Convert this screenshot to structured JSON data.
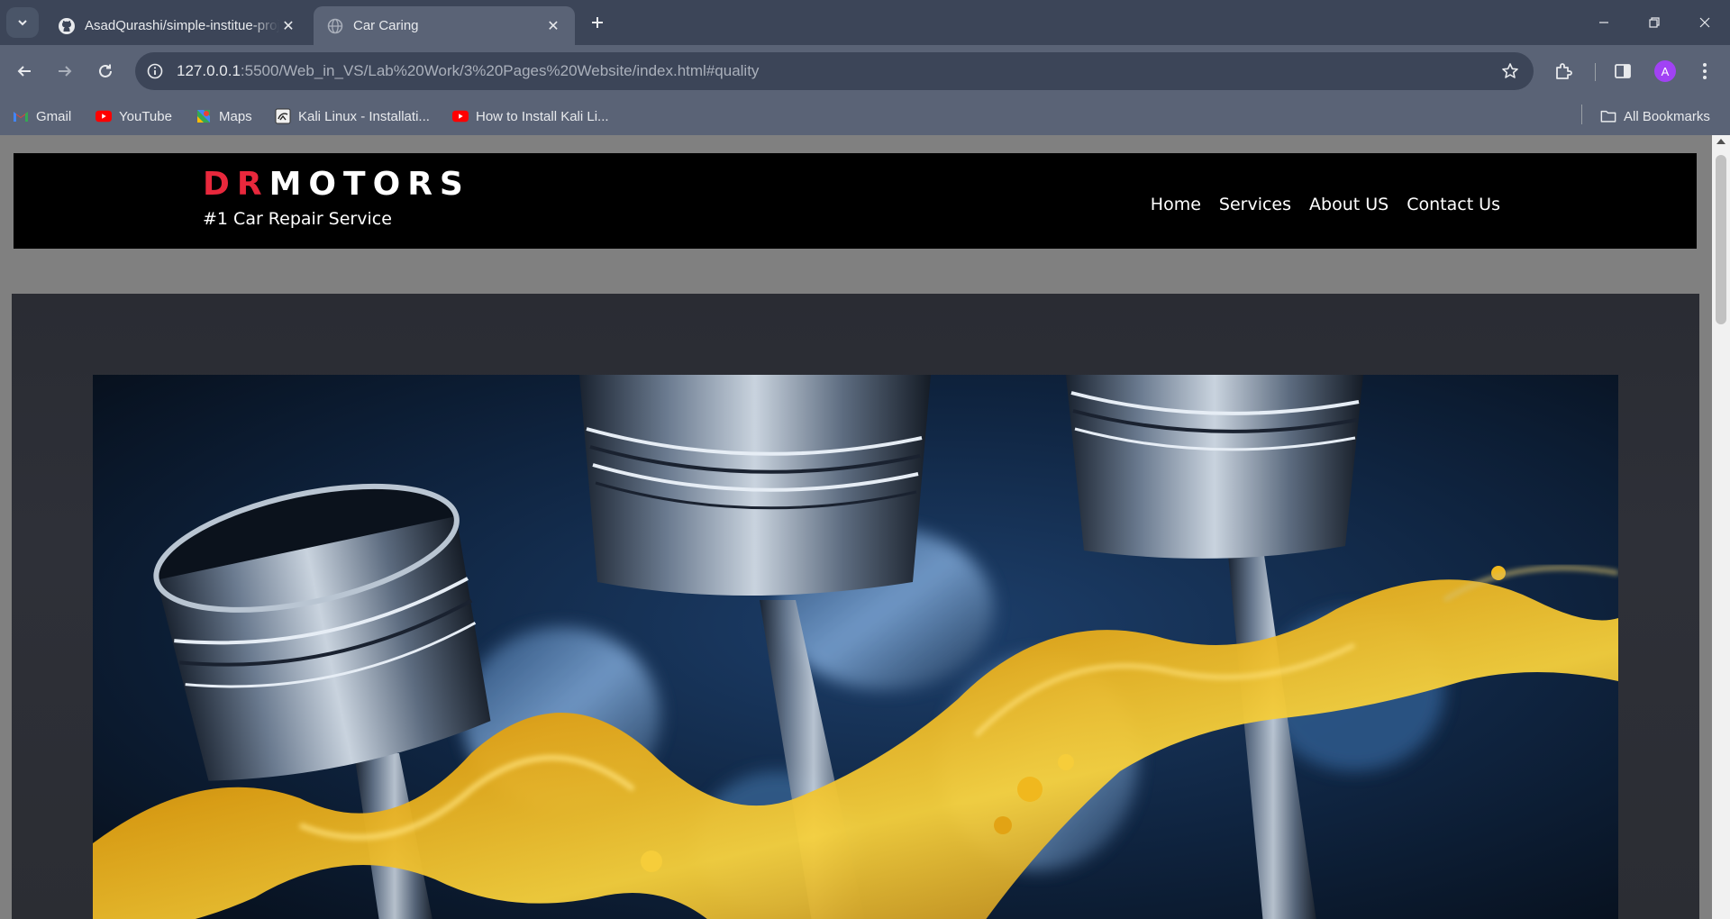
{
  "browser": {
    "tabs": [
      {
        "title": "AsadQurashi/simple-institue-project",
        "icon": "github-icon",
        "active": false
      },
      {
        "title": "Car Caring",
        "icon": "globe-icon",
        "active": true
      }
    ],
    "url": {
      "host": "127.0.0.1",
      "rest": ":5500/Web_in_VS/Lab%20Work/3%20Pages%20Website/index.html#quality"
    },
    "bookmarks": [
      {
        "label": "Gmail",
        "icon": "gmail-icon"
      },
      {
        "label": "YouTube",
        "icon": "youtube-icon"
      },
      {
        "label": "Maps",
        "icon": "maps-icon"
      },
      {
        "label": "Kali Linux - Installati...",
        "icon": "kali-icon"
      },
      {
        "label": "How to Install Kali Li...",
        "icon": "youtube-icon"
      }
    ],
    "all_bookmarks_label": "All Bookmarks",
    "profile_initial": "A"
  },
  "site": {
    "logo": {
      "accent": "DR",
      "main": "MOTORS"
    },
    "tagline": "#1 Car Repair Service",
    "nav": [
      "Home",
      "Services",
      "About US",
      "Contact Us"
    ],
    "colors": {
      "accent": "#e8283c",
      "header_bg": "#000000",
      "page_bg": "#808080"
    }
  }
}
